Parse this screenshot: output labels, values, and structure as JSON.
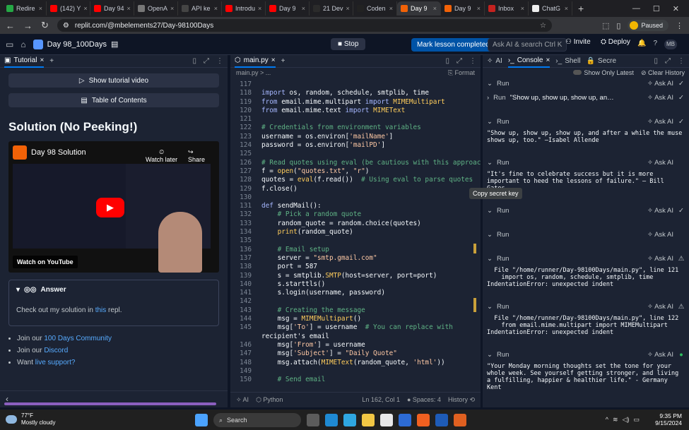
{
  "browser": {
    "tabs": [
      {
        "label": "Redire",
        "color": "#25a745"
      },
      {
        "label": "(142) Y",
        "color": "#ff0000"
      },
      {
        "label": "Day 94",
        "color": "#ff0000"
      },
      {
        "label": "OpenA",
        "color": "#777777"
      },
      {
        "label": "API ke",
        "color": "#444444"
      },
      {
        "label": "Introdu",
        "color": "#ff0000"
      },
      {
        "label": "Day 9",
        "color": "#ff0000"
      },
      {
        "label": "21 Dev",
        "color": "#2b2b2b"
      },
      {
        "label": "Coden",
        "color": "#222222"
      },
      {
        "label": "Day 9",
        "color": "#f26207",
        "active": true
      },
      {
        "label": "Day 9",
        "color": "#f26207"
      },
      {
        "label": "Inbox",
        "color": "#c5221f"
      },
      {
        "label": "ChatG",
        "color": "#eeeeee"
      }
    ],
    "url": "replit.com/@mbelements27/Day-98100Days",
    "profile_status": "Paused"
  },
  "replit": {
    "repl_name": "Day 98_100Days",
    "stop_label": "Stop",
    "mark_label": "Mark lesson completed",
    "ask_label": "Ask AI & search",
    "ask_shortcut": "Ctrl K",
    "invite_label": "Invite",
    "deploy_label": "Deploy",
    "avatar_initials": "MB"
  },
  "tutorial": {
    "tab_label": "Tutorial",
    "show_video_label": "Show tutorial video",
    "toc_label": "Table of Contents",
    "title": "Solution (No Peeking!)",
    "video": {
      "title": "Day 98 Solution",
      "watch_later": "Watch later",
      "share": "Share",
      "watch_on": "Watch on",
      "youtube": "YouTube"
    },
    "answer": {
      "heading": "Answer",
      "text_before": "Check out my solution in ",
      "link": "this",
      "text_after": " repl."
    },
    "list": [
      {
        "before": "Join our ",
        "link": "100 Days Community",
        "after": ""
      },
      {
        "before": "Join our ",
        "link": "Discord",
        "after": ""
      },
      {
        "before": "Want ",
        "link": "live support?",
        "after": ""
      }
    ]
  },
  "editor": {
    "tab_label": "main.py",
    "breadcrumb": "main.py > ...",
    "format_label": "Format",
    "status": {
      "ai": "AI",
      "lang": "Python",
      "cursor": "Ln 162, Col 1",
      "spaces": "Spaces: 4",
      "history": "History"
    },
    "lines": [
      {
        "n": "117",
        "t": ""
      },
      {
        "n": "118",
        "t": "import os, random, schedule, smtplib, time"
      },
      {
        "n": "119",
        "t": "from email.mime.multipart import MIMEMultipart"
      },
      {
        "n": "120",
        "t": "from email.mime.text import MIMEText"
      },
      {
        "n": "121",
        "t": ""
      },
      {
        "n": "122",
        "t": "# Credentials from environment variables"
      },
      {
        "n": "123",
        "t": "username = os.environ['mailName']"
      },
      {
        "n": "124",
        "t": "password = os.environ['mailPD']"
      },
      {
        "n": "125",
        "t": ""
      },
      {
        "n": "126",
        "t": "# Read quotes using eval (be cautious with this approach)"
      },
      {
        "n": "127",
        "t": "f = open(\"quotes.txt\", \"r\")"
      },
      {
        "n": "128",
        "t": "quotes = eval(f.read())  # Using eval to parse quotes"
      },
      {
        "n": "129",
        "t": "f.close()"
      },
      {
        "n": "130",
        "t": ""
      },
      {
        "n": "131",
        "t": "def sendMail():"
      },
      {
        "n": "132",
        "t": "    # Pick a random quote"
      },
      {
        "n": "133",
        "t": "    random_quote = random.choice(quotes)"
      },
      {
        "n": "134",
        "t": "    print(random_quote)"
      },
      {
        "n": "135",
        "t": ""
      },
      {
        "n": "136",
        "t": "    # Email setup"
      },
      {
        "n": "137",
        "t": "    server = \"smtp.gmail.com\""
      },
      {
        "n": "138",
        "t": "    port = 587"
      },
      {
        "n": "139",
        "t": "    s = smtplib.SMTP(host=server, port=port)"
      },
      {
        "n": "140",
        "t": "    s.starttls()"
      },
      {
        "n": "141",
        "t": "    s.login(username, password)"
      },
      {
        "n": "142",
        "t": ""
      },
      {
        "n": "143",
        "t": "    # Creating the message"
      },
      {
        "n": "144",
        "t": "    msg = MIMEMultipart()"
      },
      {
        "n": "145",
        "t": "    msg['To'] = username  # You can replace with"
      },
      {
        "n": "",
        "t": "recipient's email"
      },
      {
        "n": "146",
        "t": "    msg['From'] = username"
      },
      {
        "n": "147",
        "t": "    msg['Subject'] = \"Daily Quote\""
      },
      {
        "n": "148",
        "t": "    msg.attach(MIMEText(random_quote, 'html'))"
      },
      {
        "n": "149",
        "t": ""
      },
      {
        "n": "150",
        "t": "    # Send email"
      }
    ]
  },
  "console": {
    "tabs": [
      "AI",
      "Console",
      "Shell",
      "Secre"
    ],
    "show_only_latest": "Show Only Latest",
    "clear_history": "Clear History",
    "run_label": "Run",
    "ask_label": "Ask AI",
    "tooltip": "Copy secret key",
    "entries": [
      {
        "collapsed": "",
        "output": "",
        "status": "ok"
      },
      {
        "collapsed": "\"Show up, show up, show up, an…",
        "output": "",
        "status": "ok"
      },
      {
        "collapsed": "",
        "output": "\"Show up, show up, show up, and after a while the muse shows up, too.\" —Isabel Allende",
        "status": "ok"
      },
      {
        "collapsed": "",
        "output": "\"It's fine to celebrate success but it is more important to heed the lessons of failure.\" – Bill Gates",
        "status": "none"
      },
      {
        "collapsed": "",
        "output": "",
        "status": "ok"
      },
      {
        "collapsed": "",
        "output": "",
        "status": "none"
      },
      {
        "collapsed": "",
        "output": "  File \"/home/runner/Day-98100Days/main.py\", line 121\n    import os, random, schedule, smtplib, time\nIndentationError: unexpected indent",
        "status": "warn"
      },
      {
        "collapsed": "",
        "output": "  File \"/home/runner/Day-98100Days/main.py\", line 122\n    from email.mime.multipart import MIMEMultipart\nIndentationError: unexpected indent",
        "status": "warn"
      },
      {
        "collapsed": "",
        "output": "\"Your Monday morning thoughts set the tone for your whole week. See yourself getting stronger, and living a fulfilling, happier & healthier life.\" - Germany Kent",
        "status": "running"
      }
    ]
  },
  "taskbar": {
    "temp": "77°F",
    "weather": "Mostly cloudy",
    "search": "Search",
    "time": "9:35 PM",
    "date": "9/15/2024"
  }
}
